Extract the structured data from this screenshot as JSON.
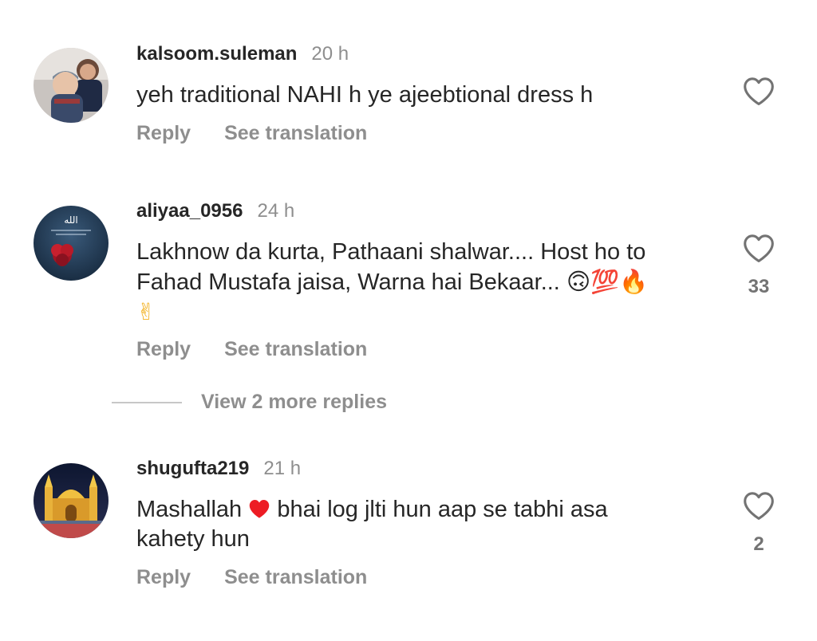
{
  "comments": [
    {
      "username": "kalsoom.suleman",
      "time": "20 h",
      "text": "yeh traditional NAHI h ye ajeebtional dress h",
      "likes": "",
      "reply_label": "Reply",
      "translate_label": "See translation"
    },
    {
      "username": "aliyaa_0956",
      "time": "24 h",
      "text_line1": "Lakhnow da kurta, Pathaani shalwar.... Host ho to",
      "text_line2": "Fahad Mustafa jaisa, Warna hai Bekaar...",
      "emoji_line2": "🙃💯🔥",
      "emoji_line3": "✌",
      "likes": "33",
      "reply_label": "Reply",
      "translate_label": "See translation",
      "avatar_text": "الله"
    },
    {
      "username": "shugufta219",
      "time": "21 h",
      "text_line1a": "Mashallah",
      "text_line1b": "bhai log jlti hun aap se tabhi asa",
      "text_line2": "kahety hun",
      "likes": "2",
      "reply_label": "Reply",
      "translate_label": "See translation"
    }
  ],
  "view_more_replies": "View 2 more replies",
  "colors": {
    "text": "#262626",
    "secondary": "#8e8e8e",
    "heart_red": "#ed1c24"
  },
  "icons": {
    "like": "heart-outline-icon",
    "heart_emoji": "red-heart-icon"
  }
}
